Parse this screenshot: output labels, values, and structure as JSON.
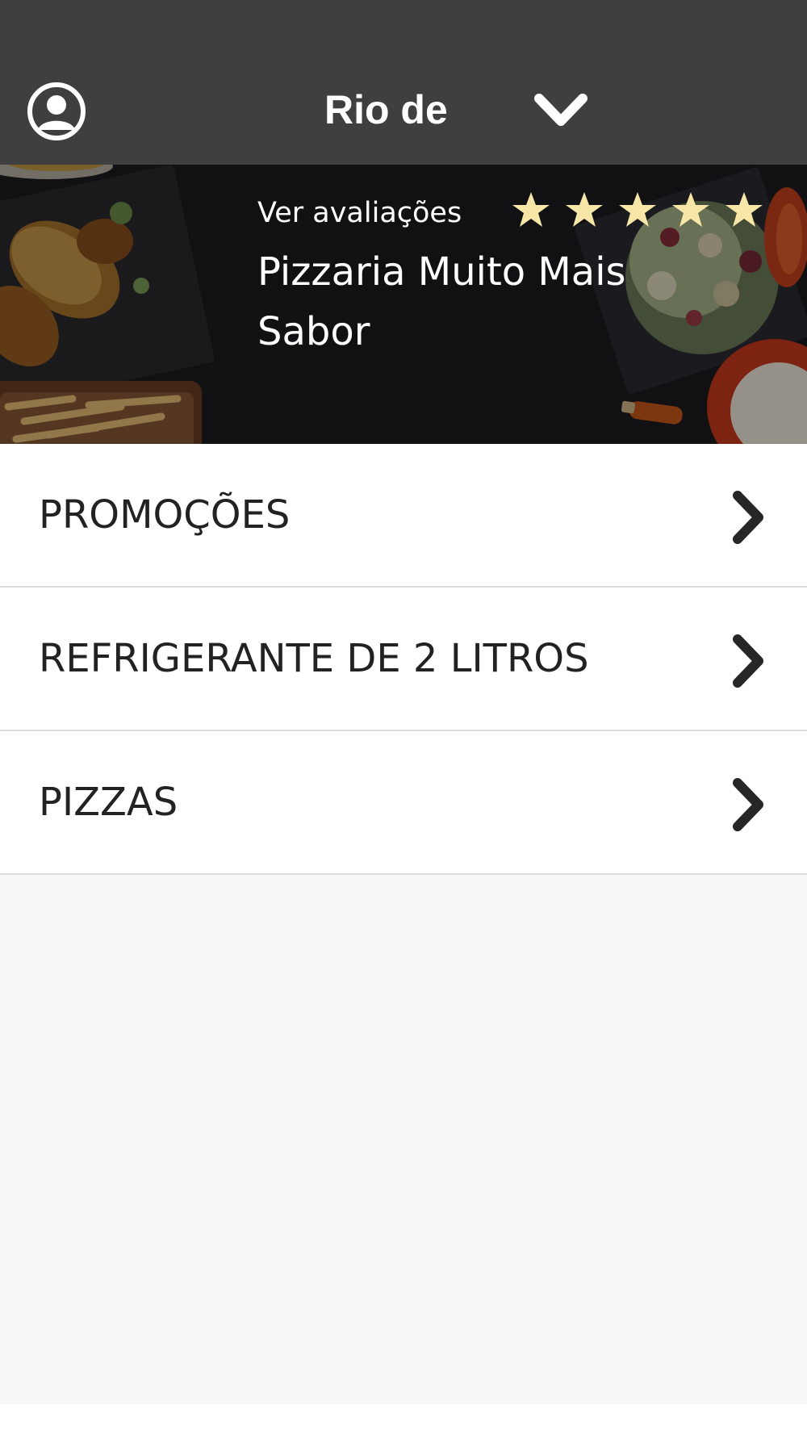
{
  "header": {
    "city": "Rio de",
    "profile_icon": "user-circle-icon",
    "dropdown_icon": "chevron-down-icon",
    "background_color": "#3f3f3f"
  },
  "banner": {
    "reviews_label": "Ver avaliações",
    "restaurant_name": "Pizzaria Muito Mais Sabor",
    "rating": 5,
    "rating_max": 5,
    "star_color": "#f6e7a8"
  },
  "categories": [
    {
      "label": "PROMOÇÕES",
      "icon": "chevron-right-icon"
    },
    {
      "label": "REFRIGERANTE DE 2 LITROS",
      "icon": "chevron-right-icon"
    },
    {
      "label": "PIZZAS",
      "icon": "chevron-right-icon"
    }
  ],
  "colors": {
    "page_background": "#f7f7f7",
    "list_background": "#ffffff",
    "text_dark": "#222222"
  }
}
